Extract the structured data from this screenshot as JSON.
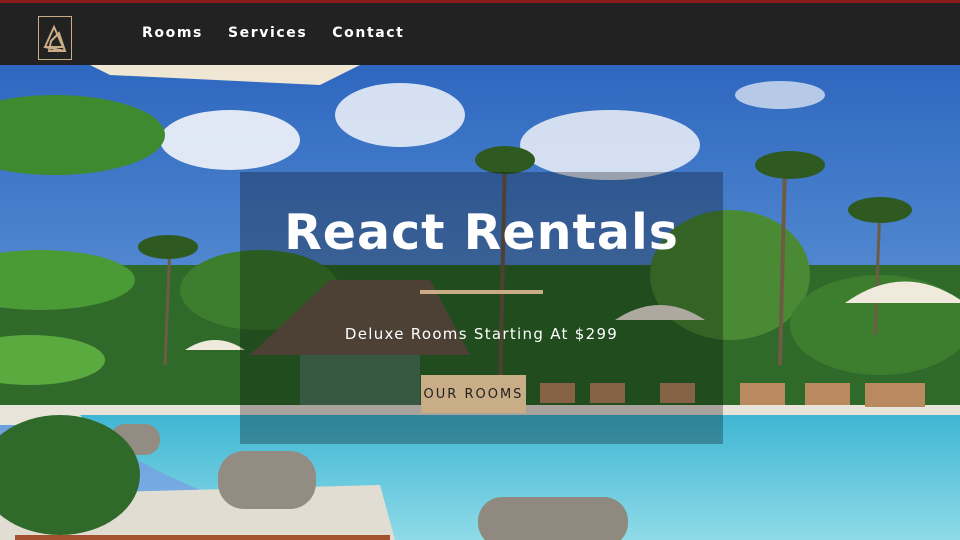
{
  "brand": {
    "logo_icon": "pyramid-logo-icon"
  },
  "nav": {
    "items": [
      "Rooms",
      "Services",
      "Contact"
    ]
  },
  "hero": {
    "title": "React Rentals",
    "subtitle": "Deluxe Rooms Starting At $299",
    "cta_label": "OUR ROOMS"
  },
  "colors": {
    "accent": "#c9ad87",
    "nav_bg": "#222222",
    "top_line": "#8b1a1a",
    "sky": "#3d7fd0",
    "pool": "#5cc6dc"
  }
}
